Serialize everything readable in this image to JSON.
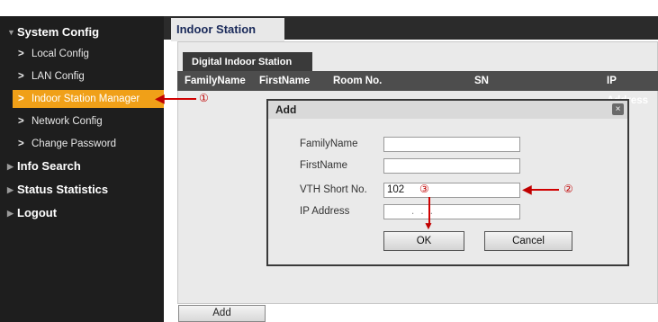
{
  "sidebar": {
    "items": [
      {
        "label": "System Config",
        "type": "header"
      },
      {
        "label": "Local Config",
        "type": "sub"
      },
      {
        "label": "LAN Config",
        "type": "sub"
      },
      {
        "label": "Indoor Station Manager",
        "type": "sub",
        "active": true
      },
      {
        "label": "Network Config",
        "type": "sub"
      },
      {
        "label": "Change Password",
        "type": "sub"
      },
      {
        "label": "Info Search",
        "type": "header"
      },
      {
        "label": "Status Statistics",
        "type": "header"
      },
      {
        "label": "Logout",
        "type": "header"
      }
    ]
  },
  "main": {
    "tab": "Indoor Station",
    "subtab": "Digital Indoor Station",
    "columns": [
      "FamilyName",
      "FirstName",
      "Room No.",
      "SN",
      "IP Address"
    ],
    "add_button": "Add"
  },
  "dialog": {
    "title": "Add",
    "close": "×",
    "fields": [
      {
        "label": "FamilyName",
        "value": ""
      },
      {
        "label": "FirstName",
        "value": ""
      },
      {
        "label": "VTH Short No.",
        "value": "102"
      },
      {
        "label": "IP Address",
        "value": ".      .      ."
      }
    ],
    "ok": "OK",
    "cancel": "Cancel"
  },
  "annotations": {
    "step1": "①",
    "step2": "②",
    "step3": "③"
  },
  "colors": {
    "sidebar_bg": "#1e1e1e",
    "active_item": "#f0a018",
    "annotation": "#d00000"
  }
}
